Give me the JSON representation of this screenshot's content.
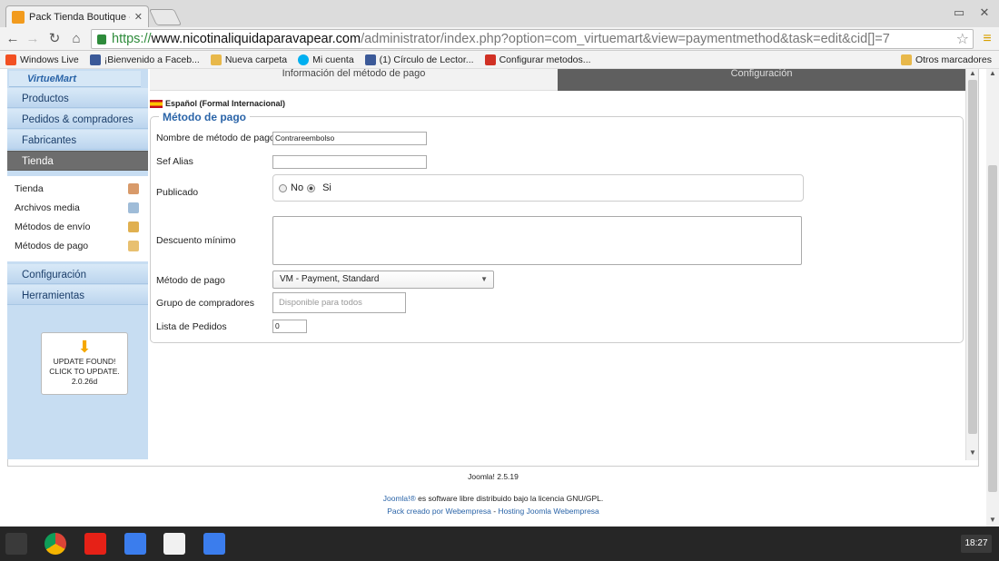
{
  "browser": {
    "tab_title": "Pack Tienda Boutique - Ad",
    "url_scheme": "https://",
    "url_host": "www.nicotinaliquidaparavapear.com",
    "url_path": "/administrator/index.php?option=com_virtuemart&view=paymentmethod&task=edit&cid[]=7",
    "bookmarks": [
      {
        "label": "Windows Live",
        "color": "#f25022"
      },
      {
        "label": "¡Bienvenido a Faceb...",
        "color": "#3b5998"
      },
      {
        "label": "Nueva carpeta",
        "color": "#e8b84a"
      },
      {
        "label": "Mi cuenta",
        "color": "#00aff0"
      },
      {
        "label": "(1) Círculo de Lector...",
        "color": "#3b5998"
      },
      {
        "label": "Configurar metodos...",
        "color": "#d03024"
      }
    ],
    "other_bookmarks": "Otros marcadores"
  },
  "sidebar": {
    "logo": "VirtueMart",
    "menu": [
      {
        "label": "Productos",
        "active": false
      },
      {
        "label": "Pedidos & compradores",
        "active": false
      },
      {
        "label": "Fabricantes",
        "active": false
      },
      {
        "label": "Tienda",
        "active": true
      }
    ],
    "submenu": [
      "Tienda",
      "Archivos media",
      "Métodos de envío",
      "Métodos de pago"
    ],
    "menu2": [
      "Configuración",
      "Herramientas"
    ],
    "update": {
      "line1": "UPDATE FOUND!",
      "line2": "CLICK TO UPDATE.",
      "line3": "2.0.26d"
    }
  },
  "tabs": {
    "info": "Información del método de pago",
    "config": "Configuración"
  },
  "language": "Español (Formal Internacional)",
  "form": {
    "legend": "Método de pago",
    "name_label": "Nombre de método de pago",
    "name_value": "Contrareembolso",
    "alias_label": "Sef Alias",
    "alias_value": "",
    "published_label": "Publicado",
    "published_no": "No",
    "published_yes": "Si",
    "discount_label": "Descuento mínimo",
    "method_label": "Método de pago",
    "method_value": "VM - Payment, Standard",
    "group_label": "Grupo de compradores",
    "group_placeholder": "Disponible para todos",
    "order_label": "Lista de Pedidos",
    "order_value": "0"
  },
  "footer": {
    "version": "Joomla! 2.5.19",
    "license_link": "Joomla!®",
    "license_text": " es software libre distribuido bajo la licencia GNU/GPL.",
    "credit_link1": "Pack creado por Webempresa",
    "credit_sep": " - ",
    "credit_link2": "Hosting Joomla Webempresa"
  },
  "taskbar": {
    "clock": "18:27",
    "apps": [
      "launcher",
      "chrome",
      "youtube",
      "docs",
      "gmail",
      "google"
    ]
  }
}
